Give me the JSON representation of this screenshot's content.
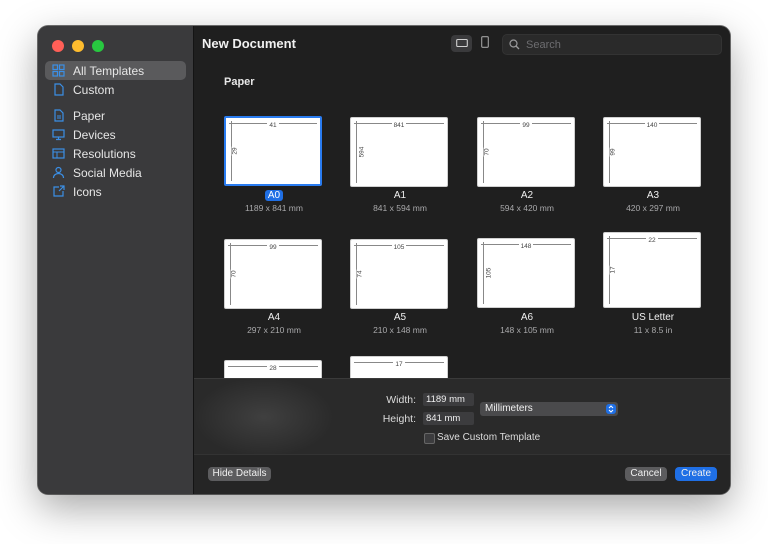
{
  "window": {
    "title": "New Document"
  },
  "search": {
    "placeholder": "Search"
  },
  "sidebar": {
    "items": [
      {
        "label": "All Templates",
        "icon": "grid-icon"
      },
      {
        "label": "Custom",
        "icon": "document-icon"
      },
      {
        "label": "Paper",
        "icon": "paper-icon"
      },
      {
        "label": "Devices",
        "icon": "monitor-icon"
      },
      {
        "label": "Resolutions",
        "icon": "resolution-icon"
      },
      {
        "label": "Social Media",
        "icon": "person-icon"
      },
      {
        "label": "Icons",
        "icon": "icon-export-icon"
      }
    ]
  },
  "content": {
    "section_title": "Paper",
    "tiles": [
      {
        "name": "A0",
        "size": "1189 x 841 mm",
        "top_dim": "41",
        "side_dim": "29"
      },
      {
        "name": "A1",
        "size": "841 x 594 mm",
        "top_dim": "841",
        "side_dim": "594"
      },
      {
        "name": "A2",
        "size": "594 x 420 mm",
        "top_dim": "99",
        "side_dim": "70"
      },
      {
        "name": "A3",
        "size": "420 x 297 mm",
        "top_dim": "140",
        "side_dim": "99"
      },
      {
        "name": "A4",
        "size": "297 x 210 mm",
        "top_dim": "99",
        "side_dim": "70"
      },
      {
        "name": "A5",
        "size": "210 x 148 mm",
        "top_dim": "105",
        "side_dim": "74"
      },
      {
        "name": "A6",
        "size": "148 x 105 mm",
        "top_dim": "148",
        "side_dim": "105"
      },
      {
        "name": "US Letter",
        "size": "11 x 8.5 in",
        "top_dim": "22",
        "side_dim": "17"
      },
      {
        "name": "",
        "size": "",
        "top_dim": "28",
        "side_dim": ""
      },
      {
        "name": "",
        "size": "",
        "top_dim": "17",
        "side_dim": ""
      }
    ]
  },
  "details": {
    "width_label": "Width:",
    "width_value": "1189 mm",
    "height_label": "Height:",
    "height_value": "841 mm",
    "unit": "Millimeters",
    "save_custom_label": "Save Custom Template"
  },
  "footer": {
    "hide_details": "Hide Details",
    "cancel": "Cancel",
    "create": "Create"
  },
  "colors": {
    "accent": "#1f6fe5",
    "sidebar_icon": "#3b8fe6"
  }
}
